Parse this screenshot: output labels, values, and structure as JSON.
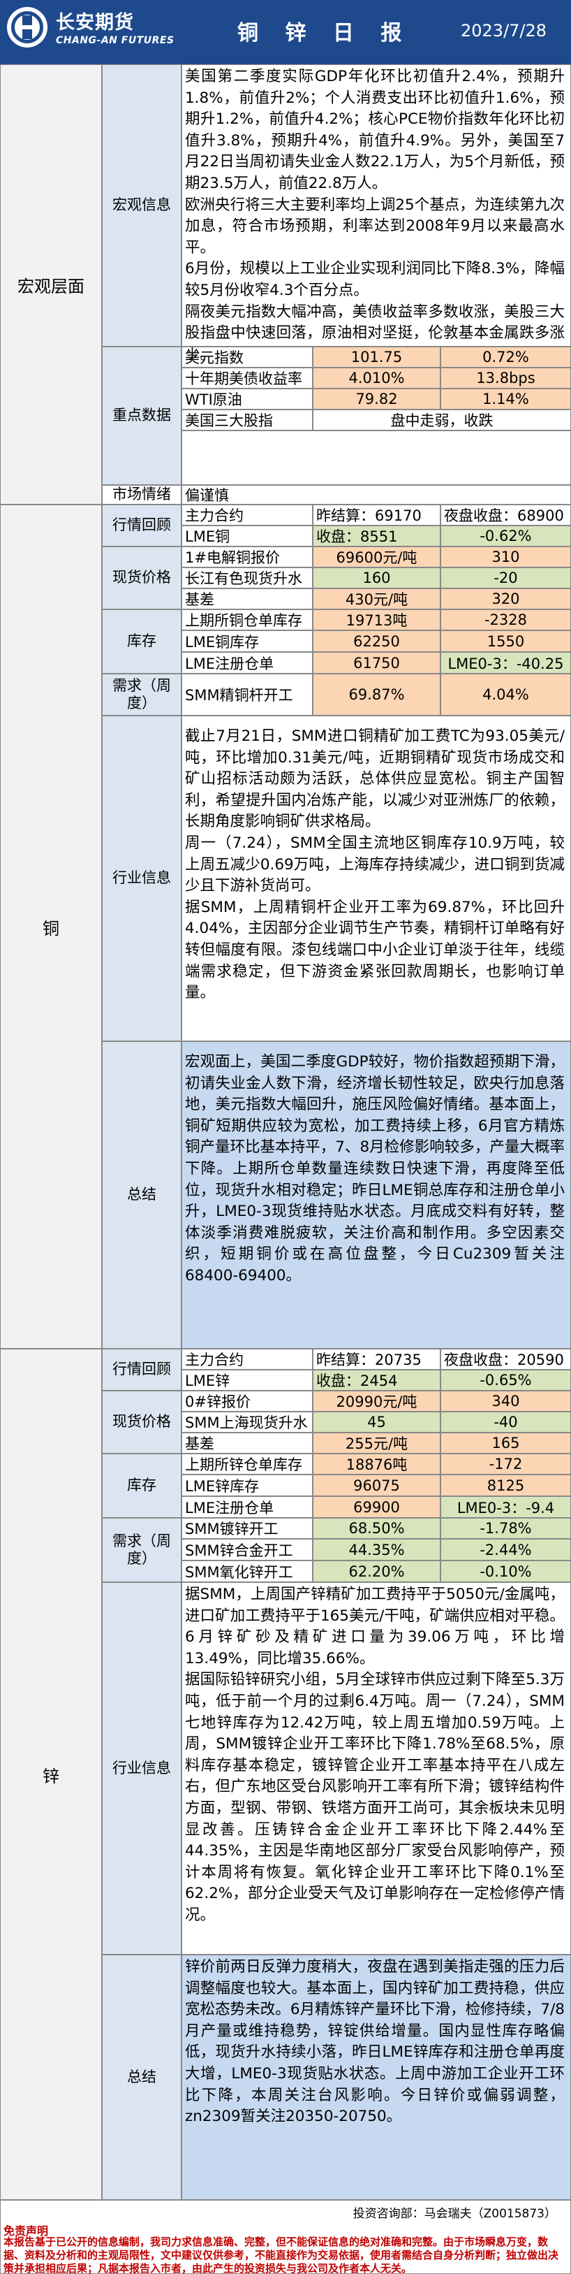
{
  "header": {
    "company_cn": "长安期货",
    "company_en": "CHANG-AN FUTURES",
    "title": "铜 锌 日 报",
    "date": "2023/7/28"
  },
  "macro": {
    "category": "宏观层面",
    "info_label": "宏观信息",
    "info_paragraphs": [
      "美国第二季度实际GDP年化环比初值升2.4%，预期升1.8%，前值升2%；个人消费支出环比初值升1.6%，预期升1.2%，前值升4.2%；核心PCE物价指数年化环比初值升3.8%，预期升4%，前值升4.9%。另外，美国至7月22日当周初请失业金人数22.1万人，为5个月新低，预期23.5万人，前值22.8万人。",
      "欧洲央行将三大主要利率均上调25个基点，为连续第九次加息，符合市场预期，利率达到2008年9月以来最高水平。",
      "6月份，规模以上工业企业实现利润同比下降8.3%，降幅较5月份收窄4.3个百分点。",
      "隔夜美元指数大幅冲高，美债收益率多数收涨，美股三大股指盘中快速回落，原油相对坚挺，伦敦基本金属跌多涨少。"
    ],
    "key_label": "重点数据",
    "key_rows": [
      {
        "name": "美元指数",
        "v1": "101.75",
        "v2": "0.72%"
      },
      {
        "name": "十年期美债收益率",
        "v1": "4.010%",
        "v2": "13.8bps"
      },
      {
        "name": "WTI原油",
        "v1": "79.82",
        "v2": "1.14%"
      },
      {
        "name": "美国三大股指",
        "v1": "盘中走弱，收跌",
        "v2": ""
      }
    ],
    "sentiment_label": "市场情绪",
    "sentiment_value": "偏谨慎"
  },
  "copper": {
    "category": "铜",
    "market_label": "行情回顾",
    "main_contract": "主力合约",
    "settle": "昨结算：69170",
    "night_close": "夜盘收盘：68900",
    "futures_name": "LME铜",
    "futures_close": "收盘：8551",
    "futures_change": "-0.62%",
    "spot_label": "现货价格",
    "spot_rows": [
      {
        "name": "1#电解铜报价",
        "v1": "69600元/吨",
        "v2": "310"
      },
      {
        "name": "长江有色现货升水",
        "v1": "160",
        "v2": "-20"
      },
      {
        "name": "基差",
        "v1": "430元/吨",
        "v2": "320"
      }
    ],
    "inv_label": "库存",
    "inv_rows": [
      {
        "name": "上期所铜仓单库存",
        "v1": "19713吨",
        "v2": "-2328"
      },
      {
        "name": "LME铜库存",
        "v1": "62250",
        "v2": "1550"
      },
      {
        "name": "LME注册仓单",
        "v1": "61750",
        "v2": "LME0-3：-40.25"
      }
    ],
    "demand_label": "需求（周度）",
    "demand_rows": [
      {
        "name": "SMM精铜杆开工",
        "v1": "69.87%",
        "v2": "4.04%"
      }
    ],
    "industry_label": "行业信息",
    "industry_paragraphs": [
      "截止7月21日，SMM进口铜精矿加工费TC为93.05美元/吨，环比增加0.31美元/吨，近期铜精矿现货市场成交和矿山招标活动颇为活跃，总体供应显宽松。铜主产国智利，希望提升国内冶炼产能，以减少对亚洲炼厂的依赖，长期角度影响铜矿供求格局。",
      "周一（7.24），SMM全国主流地区铜库存10.9万吨，较上周五减少0.69万吨，上海库存持续减少，进口铜到货减少且下游补货尚可。",
      "据SMM，上周精铜杆企业开工率为69.87%，环比回升4.04%，主因部分企业调节生产节奏，精铜杆订单略有好转但幅度有限。漆包线端口中小企业订单淡于往年，线缆端需求稳定，但下游资金紧张回款周期长，也影响订单量。"
    ],
    "summary_label": "总结",
    "summary": "宏观面上，美国二季度GDP较好，物价指数超预期下滑，初请失业金人数下滑，经济增长韧性较足，欧央行加息落地，美元指数大幅回升，施压风险偏好情绪。基本面上，铜矿短期供应较为宽松，加工费持续上移，6月官方精炼铜产量环比基本持平，7、8月检修影响较多，产量大概率下降。上期所仓单数量连续数日快速下滑，再度降至低位，现货升水相对稳定；昨日LME铜总库存和注册仓单小升，LME0-3现货维持贴水状态。月底成交料有好转，整体淡季消费难脱疲软，关注价高和制作用。多空因素交织，短期铜价或在高位盘整，今日Cu2309暂关注68400-69400。"
  },
  "zinc": {
    "category": "锌",
    "market_label": "行情回顾",
    "main_contract": "主力合约",
    "settle": "昨结算：20735",
    "night_close": "夜盘收盘：20590",
    "futures_name": "LME锌",
    "futures_close": "收盘：2454",
    "futures_change": "-0.65%",
    "spot_label": "现货价格",
    "spot_rows": [
      {
        "name": "0#锌报价",
        "v1": "20990元/吨",
        "v2": "340"
      },
      {
        "name": "SMM上海现货升水",
        "v1": "45",
        "v2": "-40"
      },
      {
        "name": "基差",
        "v1": "255元/吨",
        "v2": "165"
      }
    ],
    "inv_label": "库存",
    "inv_rows": [
      {
        "name": "上期所锌仓单库存",
        "v1": "18876吨",
        "v2": "-172"
      },
      {
        "name": "LME锌库存",
        "v1": "96075",
        "v2": "8125"
      },
      {
        "name": "LME注册仓单",
        "v1": "69900",
        "v2": "LME0-3：-9.4"
      }
    ],
    "demand_label": "需求（周度）",
    "demand_rows": [
      {
        "name": "SMM镀锌开工",
        "v1": "68.50%",
        "v2": "-1.78%"
      },
      {
        "name": "SMM锌合金开工",
        "v1": "44.35%",
        "v2": "-2.44%"
      },
      {
        "name": "SMM氧化锌开工",
        "v1": "62.20%",
        "v2": "-0.10%"
      }
    ],
    "industry_label": "行业信息",
    "industry_paragraphs": [
      "据SMM，上周国产锌精矿加工费持平于5050元/金属吨，进口矿加工费持平于165美元/干吨，矿端供应相对平稳。6月锌矿砂及精矿进口量为39.06万吨，环比增13.49%，同比增35.66%。",
      "据国际铅锌研究小组，5月全球锌市供应过剩下降至5.3万吨，低于前一个月的过剩6.4万吨。周一（7.24），SMM七地锌库存为12.42万吨，较上周五增加0.59万吨。上周，SMM镀锌企业开工率环比下降1.78%至68.5%，原料库存基本稳定，镀锌管企业开工率基本持平在八成左右，但广东地区受台风影响开工率有所下滑；镀锌结构件方面，型钢、带钢、铁塔方面开工尚可，其余板块未见明显改善。压铸锌合金企业开工率环比下降2.44%至44.35%，主因是华南地区部分厂家受台风影响停产，预计本周将有恢复。氧化锌企业开工率环比下降0.1%至62.2%，部分企业受天气及订单影响存在一定检修停产情况。"
    ],
    "summary_label": "总结",
    "summary": "锌价前两日反弹力度稍大，夜盘在遇到美指走强的压力后调整幅度也较大。基本面上，国内锌矿加工费持稳，供应宽松态势未改。6月精炼锌产量环比下滑，检修持续，7/8月产量或维持稳势，锌锭供给增量。国内显性库存略偏低，现货升水持续小落，昨日LME锌库存和注册仓单再度大增，LME0-3现货贴水状态。上周中游加工企业开工环比下降，本周关注台风影响。今日锌价或偏弱调整，zn2309暂关注20350-20750。"
  },
  "footer": {
    "signature": "投资咨询部：马会瑞夫（Z0015873）",
    "disclaimer_title": "免责声明",
    "disclaimer": "本报告基于已公开的信息编制，我司力求信息准确、完整，但不能保证信息的绝对准确和完整。由于市场瞬息万变，数据、资料及分析和的主观局限性，文中建议仅供参考，不能直接作为交易依据，使用者需结合自身分析判断；独立做出决策并承担相应后果；凡据本报告入市者，由此产生的投资损失与我公司及作者本人无关。"
  }
}
